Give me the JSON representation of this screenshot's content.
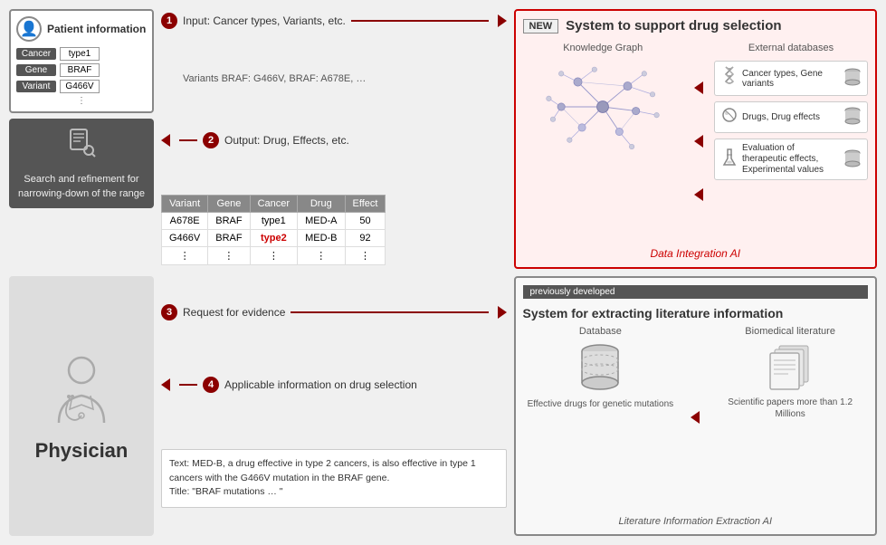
{
  "patient": {
    "title": "Patient information",
    "fields": [
      {
        "label": "Cancer",
        "value": "type1"
      },
      {
        "label": "Gene",
        "value": "BRAF"
      },
      {
        "label": "Variant",
        "value": "G466V"
      }
    ],
    "dots": "⋮"
  },
  "search": {
    "label": "Search and refinement for narrowing-down of the range"
  },
  "physician": {
    "label": "Physician"
  },
  "new_system": {
    "badge": "NEW",
    "title": "System to support drug selection",
    "kg_label": "Knowledge Graph",
    "external_db_title": "External databases",
    "db_items": [
      {
        "text": "Cancer types, Gene variants"
      },
      {
        "text": "Drugs, Drug effects"
      },
      {
        "text": "Evaluation of therapeutic effects, Experimental values"
      }
    ],
    "data_integration_label": "Data Integration AI"
  },
  "prev_system": {
    "badge": "previously developed",
    "title": "System for extracting literature information",
    "database_label": "Database",
    "database_desc": "Effective drugs for genetic mutations",
    "biomedical_label": "Biomedical literature",
    "biomedical_desc": "Scientific papers more than 1.2 Millions",
    "lit_info_label": "Literature Information Extraction AI"
  },
  "steps": {
    "step1_label": "Input: Cancer types, Variants, etc.",
    "step1_variants": "Variants BRAF: G466V, BRAF: A678E, …",
    "step2_label": "Output: Drug, Effects, etc.",
    "step3_label": "Request for evidence",
    "step4_label": "Applicable information on drug selection"
  },
  "output_table": {
    "headers": [
      "Variant",
      "Gene",
      "Cancer",
      "Drug",
      "Effect"
    ],
    "rows": [
      {
        "variant": "A678E",
        "gene": "BRAF",
        "cancer": "type1",
        "drug": "MED-A",
        "effect": "50",
        "red": false
      },
      {
        "variant": "G466V",
        "gene": "BRAF",
        "cancer": "type2",
        "drug": "MED-B",
        "effect": "92",
        "red": true
      },
      {
        "variant": "⋮",
        "gene": "⋮",
        "cancer": "⋮",
        "drug": "⋮",
        "effect": "⋮",
        "red": false
      }
    ]
  },
  "evidence_text": {
    "body": "Text: MED-B, a drug effective in type 2 cancers, is also effective in type 1 cancers with the G466V mutation in the BRAF gene.",
    "title": "Title: \"BRAF mutations … \""
  }
}
